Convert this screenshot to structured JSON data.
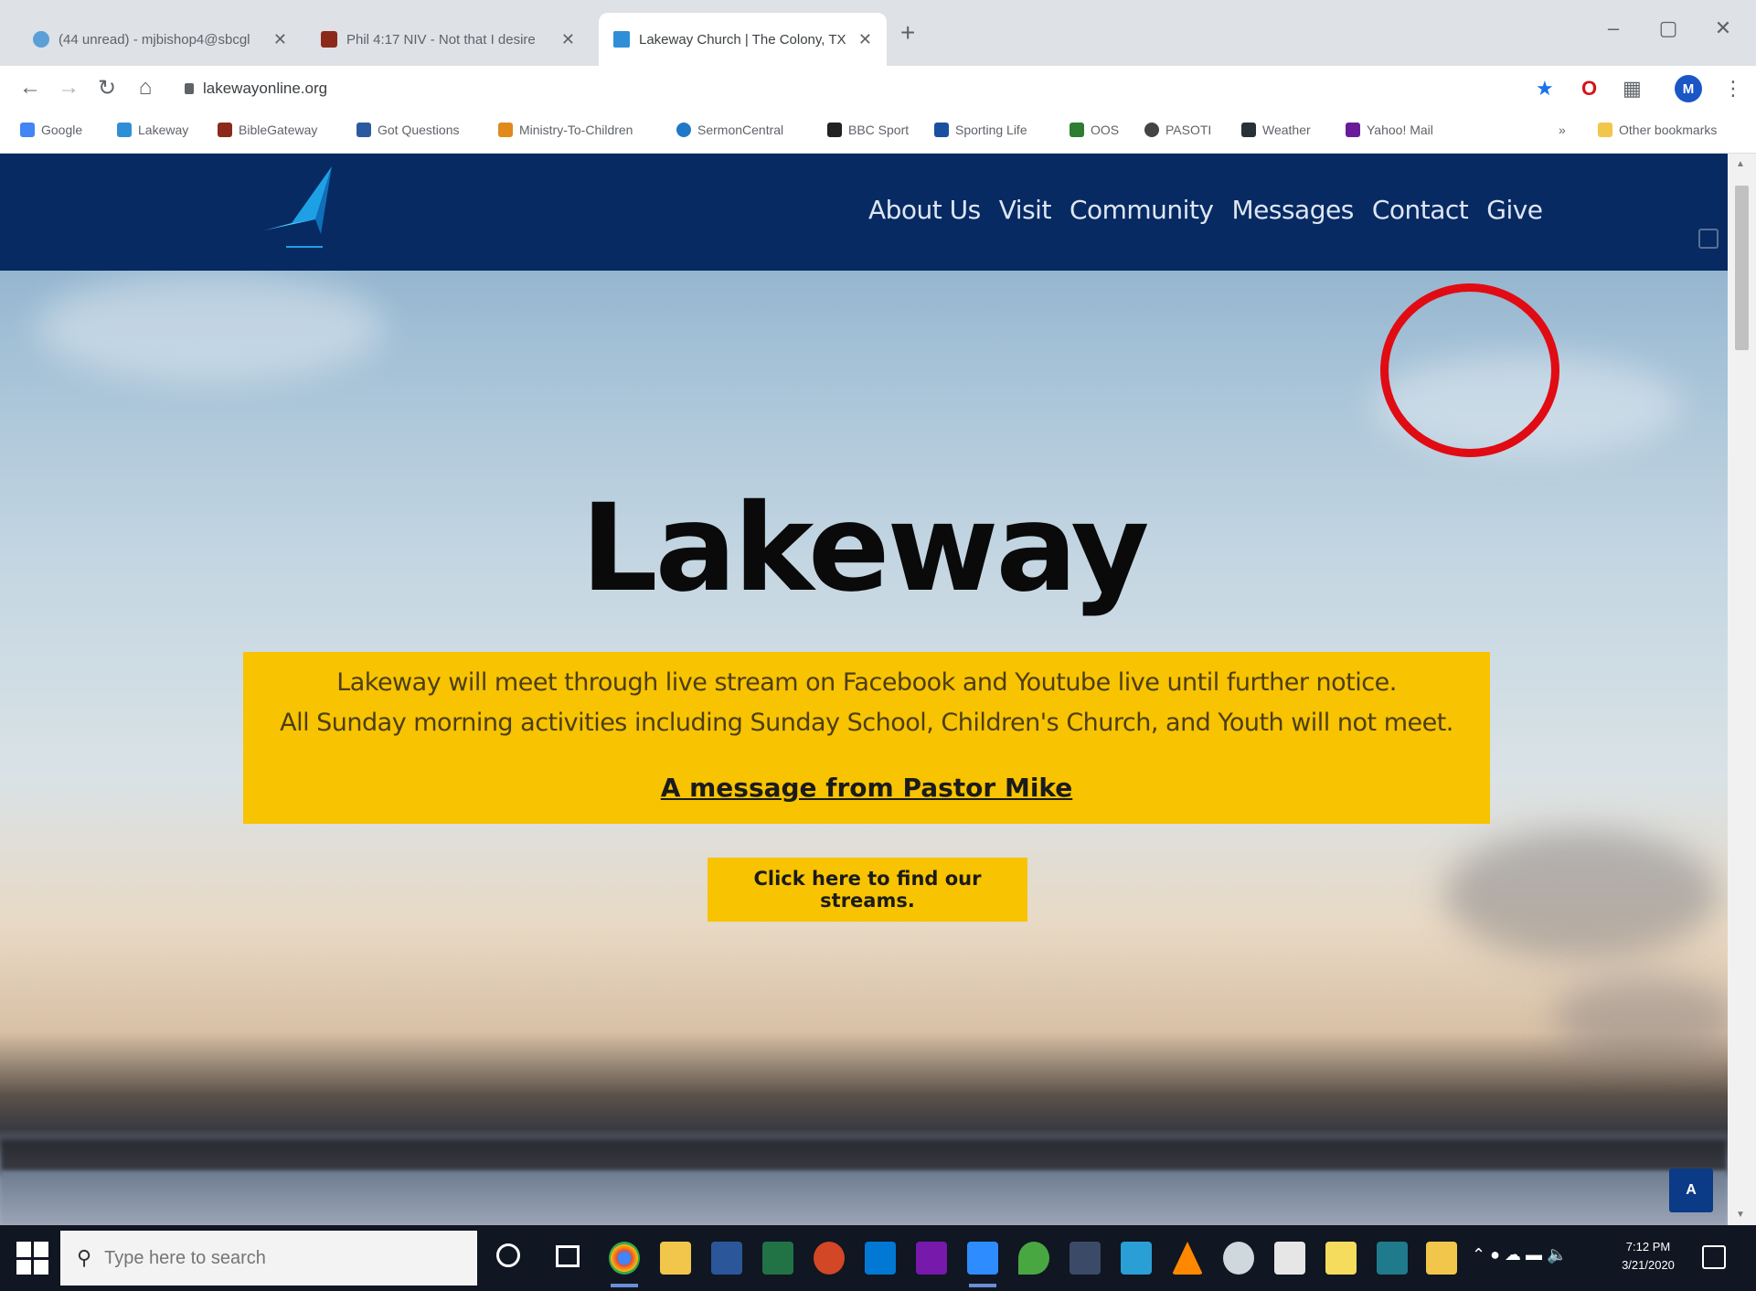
{
  "browser": {
    "tabs": [
      {
        "title": "(44 unread) - mjbishop4@sbcgl",
        "favicon_color": "#5aa0d6",
        "active": false
      },
      {
        "title": "Phil 4:17 NIV - Not that I desire",
        "favicon_color": "#8b2a1b",
        "active": false
      },
      {
        "title": "Lakeway Church | The Colony, TX",
        "favicon_color": "#2f8fd6",
        "active": true
      }
    ],
    "new_tab": "+",
    "url": "lakewayonline.org",
    "bookmarks": [
      {
        "label": "Google",
        "icon_color": "#4285f4"
      },
      {
        "label": "Lakeway",
        "icon_color": "#2f8fd6"
      },
      {
        "label": "BibleGateway",
        "icon_color": "#8b2a1b"
      },
      {
        "label": "Got Questions",
        "icon_color": "#2c5aa0"
      },
      {
        "label": "Ministry-To-Children",
        "icon_color": "#e08a1b"
      },
      {
        "label": "SermonCentral",
        "icon_color": "#1f78c8"
      },
      {
        "label": "BBC Sport",
        "icon_color": "#222222"
      },
      {
        "label": "Sporting Life",
        "icon_color": "#1a4fa0"
      },
      {
        "label": "OOS",
        "icon_color": "#2e7d32"
      },
      {
        "label": "PASOTI",
        "icon_color": "#444444"
      },
      {
        "label": "Weather",
        "icon_color": "#263238"
      },
      {
        "label": "Yahoo! Mail",
        "icon_color": "#6a1b9a"
      }
    ],
    "other_bookmarks": "Other bookmarks",
    "profile_initial": "M"
  },
  "site": {
    "nav": [
      "About Us",
      "Visit",
      "Community",
      "Messages",
      "Contact",
      "Give"
    ],
    "hero_title": "Lakeway",
    "notice_line1": "Lakeway will meet through live stream on Facebook and Youtube live until further notice.",
    "notice_line2": "All Sunday morning activities including Sunday School, Children's Church, and Youth will not meet.",
    "message_link": "A message from Pastor Mike",
    "streams_button": "Click here to find our streams.",
    "accessibility_button": "A",
    "colors": {
      "header": "#072a63",
      "accent": "#f8c300",
      "highlight_ring": "#e10b14"
    }
  },
  "taskbar": {
    "search_placeholder": "Type here to search",
    "time": "7:12 PM",
    "date": "3/21/2020"
  }
}
